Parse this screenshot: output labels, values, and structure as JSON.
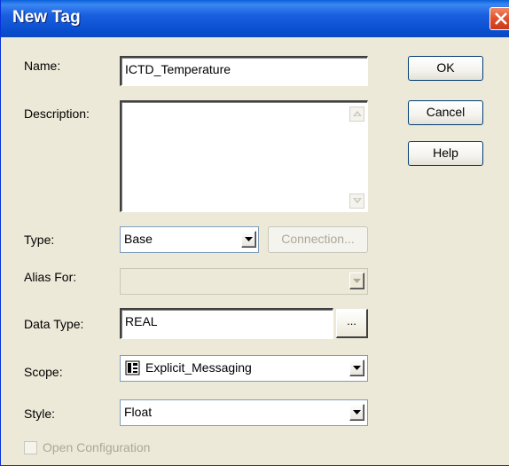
{
  "window": {
    "title": "New Tag"
  },
  "fields": {
    "name_label": "Name:",
    "name_value": "ICTD_Temperature",
    "description_label": "Description:",
    "description_value": "",
    "type_label": "Type:",
    "type_value": "Base",
    "connection_label": "Connection...",
    "alias_label": "Alias For:",
    "alias_value": "",
    "data_type_label": "Data Type:",
    "data_type_value": "REAL",
    "ellipsis_label": "...",
    "scope_label": "Scope:",
    "scope_value": "Explicit_Messaging",
    "style_label": "Style:",
    "style_value": "Float",
    "open_config_label": "Open Configuration"
  },
  "buttons": {
    "ok": "OK",
    "cancel": "Cancel",
    "help": "Help"
  },
  "colors": {
    "titlebar": "#0a4fd0",
    "dialog_bg": "#ece9d8",
    "close": "#e0502a",
    "disabled_text": "#aca899"
  },
  "icons": {
    "close": "close-icon",
    "dropdown": "chevron-down-icon",
    "scroll_up": "scroll-up-icon",
    "scroll_down": "scroll-down-icon",
    "scope": "program-icon"
  }
}
